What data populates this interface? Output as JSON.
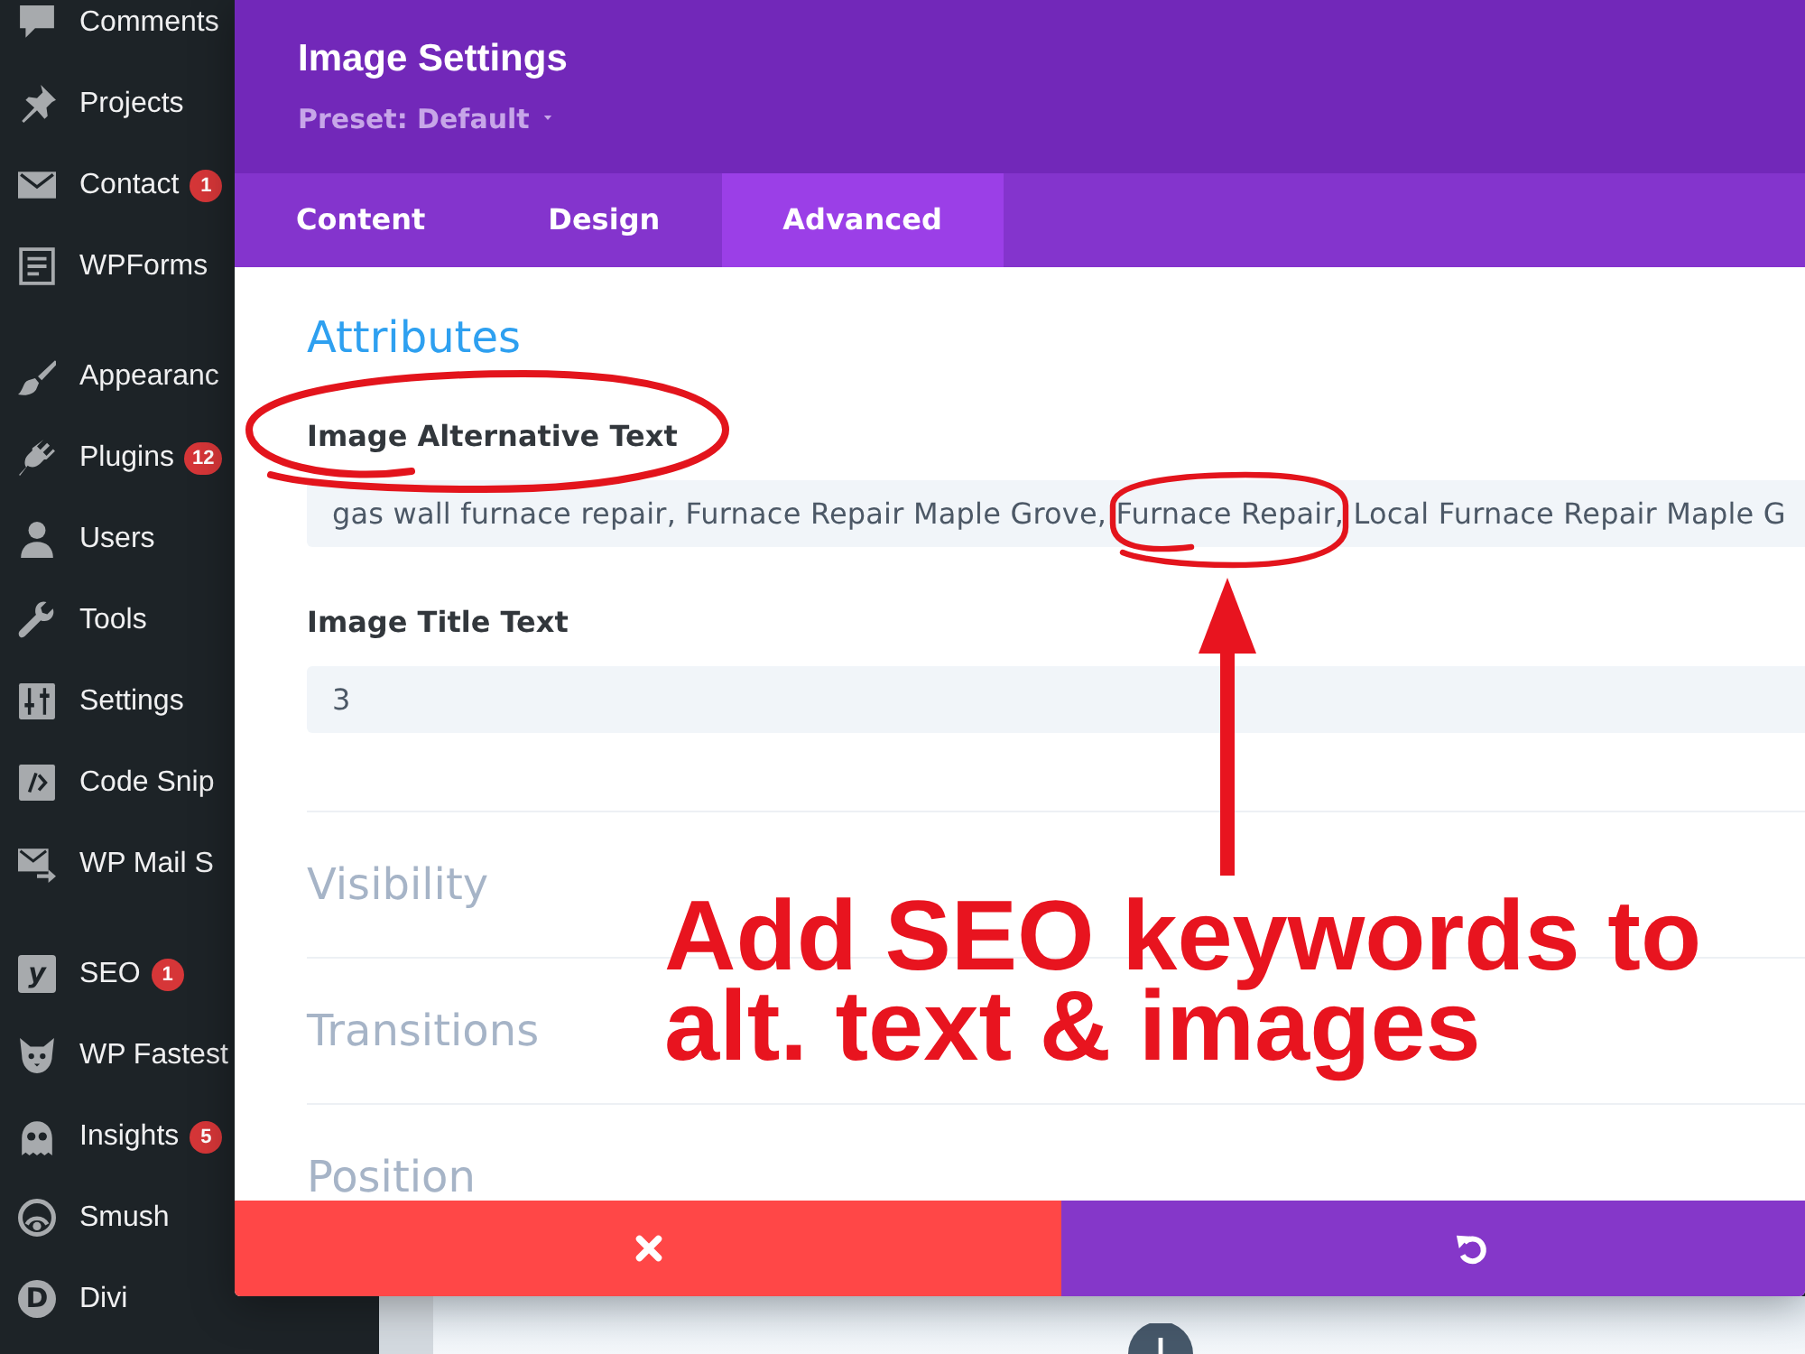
{
  "sidebar": {
    "groups": [
      {
        "items": [
          {
            "label": "Comments"
          },
          {
            "label": "Projects"
          },
          {
            "label": "Contact",
            "badge": "1"
          },
          {
            "label": "WPForms"
          }
        ]
      },
      {
        "items": [
          {
            "label": "Appearanc"
          },
          {
            "label": "Plugins",
            "badge": "12"
          },
          {
            "label": "Users"
          },
          {
            "label": "Tools"
          },
          {
            "label": "Settings"
          },
          {
            "label": "Code Snip"
          },
          {
            "label": "WP Mail S"
          }
        ]
      },
      {
        "items": [
          {
            "label": "SEO",
            "icon_letter": "y",
            "badge": "1"
          },
          {
            "label": "WP Fastest"
          },
          {
            "label": "Insights",
            "badge": "5"
          },
          {
            "label": "Smush"
          },
          {
            "label": "Divi",
            "icon_letter": "D"
          }
        ]
      }
    ]
  },
  "modal": {
    "title": "Image Settings",
    "preset": "Preset: Default",
    "tabs": [
      {
        "label": "Content",
        "selected": false
      },
      {
        "label": "Design",
        "selected": false
      },
      {
        "label": "Advanced",
        "selected": true
      }
    ],
    "sections": [
      {
        "title": "Attributes",
        "expanded": true,
        "fields": [
          {
            "label": "Image Alternative Text",
            "value": "gas wall furnace repair, Furnace Repair Maple Grove, Furnace Repair, Local Furnace Repair Maple G"
          },
          {
            "label": "Image Title Text",
            "value": "3"
          }
        ]
      },
      {
        "title": "Visibility",
        "expanded": false
      },
      {
        "title": "Transitions",
        "expanded": false
      },
      {
        "title": "Position",
        "expanded": false
      }
    ],
    "footer": {
      "buttons": [
        {
          "kind": "cancel"
        },
        {
          "kind": "undo"
        }
      ]
    }
  },
  "annotation": {
    "callout": "Add SEO keywords to alt. text & images"
  }
}
